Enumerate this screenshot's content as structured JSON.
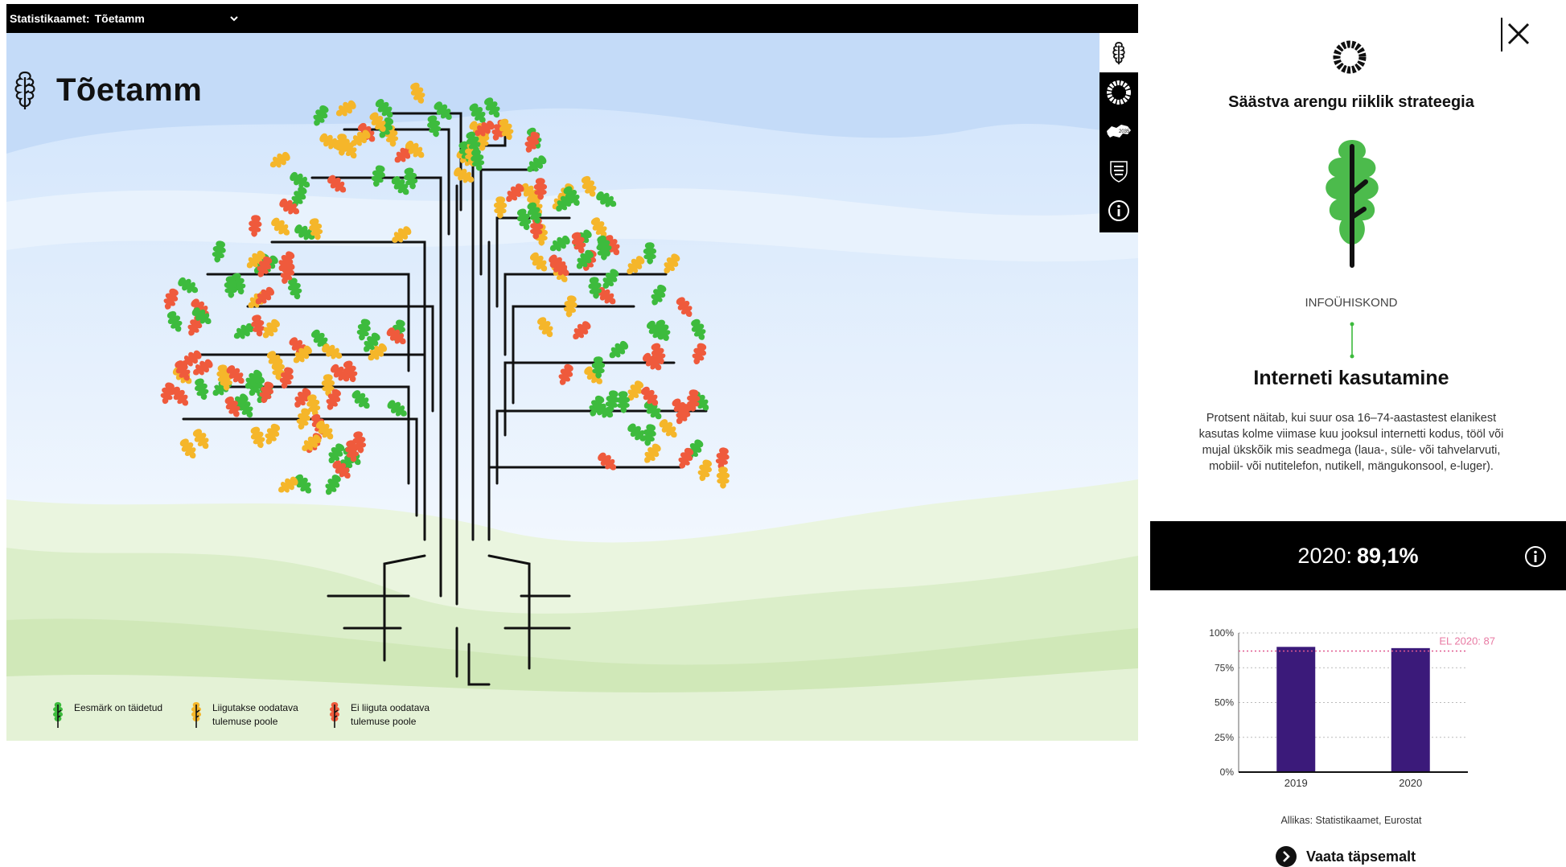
{
  "topbar": {
    "label": "Statistikaamet:",
    "selected": "Tõetamm"
  },
  "page_title": "Tõetamm",
  "legend": [
    {
      "label": "Eesmärk on täidetud",
      "color": "#3dbb3d"
    },
    {
      "label": "Liigutakse oodatava tulemuse poole",
      "color": "#f5b62a"
    },
    {
      "label": "Ei liiguta oodatava tulemuse poole",
      "color": "#ef5a3c"
    }
  ],
  "side_icons": [
    "oak-leaf-icon",
    "sdg-wheel-icon",
    "estonia-2035-icon",
    "coat-of-arms-icon",
    "info-icon"
  ],
  "panel": {
    "strategy": "Säästva arengu riiklik strateegia",
    "category": "INFOÜHISKOND",
    "indicator": "Interneti kasutamine",
    "description": "Protsent näitab, kui suur osa 16–74-aastastest elanikest kasutas kolme viimase kuu jooksul internetti kodus, tööl või mujal ükskõik mis seadmega (laua-, süle- või tahvelarvuti, mobiil- või nutitelefon, nutikell, mängukonsool, e-luger).",
    "value_year": "2020:",
    "value": "89,1%",
    "source": "Allikas: Statistikaamet, Eurostat",
    "more_label": "Vaata täpsemalt",
    "leaf_color": "#4cbb4c"
  },
  "chart_data": {
    "type": "bar",
    "categories": [
      "2019",
      "2020"
    ],
    "values": [
      90,
      89.1
    ],
    "yticks": [
      "0%",
      "25%",
      "50%",
      "75%",
      "100%"
    ],
    "ylim": [
      0,
      100
    ],
    "reference_line": {
      "label": "EL 2020: 87",
      "value": 87
    },
    "bar_color": "#3b1a7a",
    "grid": true
  }
}
